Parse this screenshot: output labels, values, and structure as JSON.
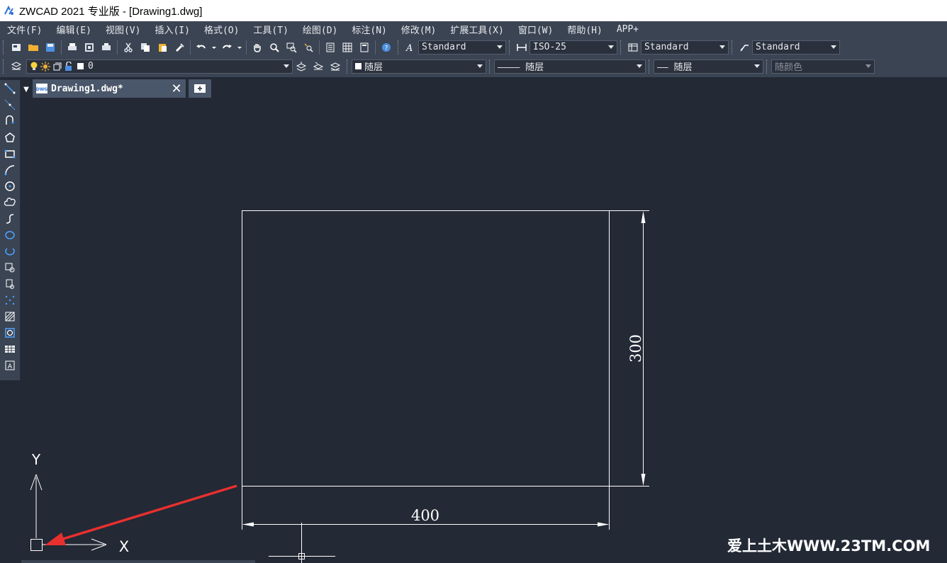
{
  "window": {
    "title": "ZWCAD 2021 专业版 - [Drawing1.dwg]"
  },
  "menu": [
    "文件(F)",
    "编辑(E)",
    "视图(V)",
    "插入(I)",
    "格式(O)",
    "工具(T)",
    "绘图(D)",
    "标注(N)",
    "修改(M)",
    "扩展工具(X)",
    "窗口(W)",
    "帮助(H)",
    "APP+"
  ],
  "styles_toolbar": {
    "text_style": "Standard",
    "dim_style": "ISO-25",
    "table_style": "Standard",
    "mleader_style": "Standard"
  },
  "layers_toolbar": {
    "current_layer": "0",
    "color": "随层",
    "linetype": "———— 随层",
    "lineweight": "—— 随层",
    "plot_style": "随颜色"
  },
  "tabs": [
    {
      "label": "Drawing1.dwg*",
      "close": "✕"
    }
  ],
  "drawing": {
    "dim_horizontal": "400",
    "dim_vertical": "300",
    "ucs_x_label": "X",
    "ucs_y_label": "Y",
    "colors": {
      "background": "#232935",
      "geometry": "#ffffff",
      "arrow": "#e8302f"
    }
  },
  "watermark": "爱上土木WWW.23TM.COM"
}
